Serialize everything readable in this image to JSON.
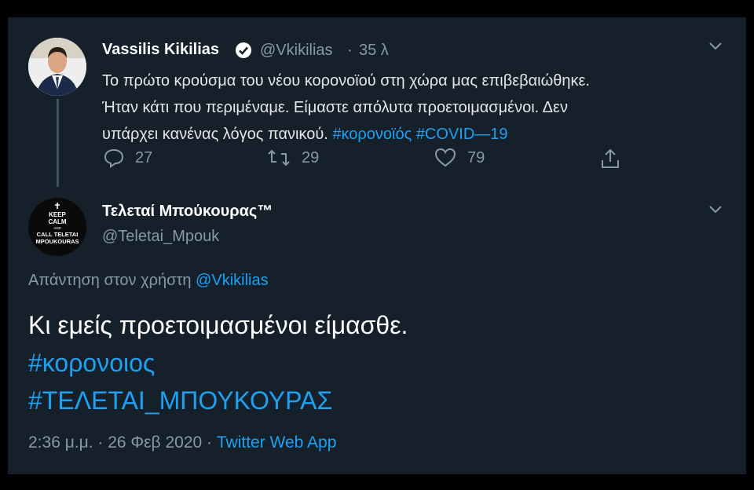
{
  "original_tweet": {
    "author_name": "Vassilis Kikilias",
    "handle": "@Vkikilias",
    "separator": "·",
    "time": "35 λ",
    "line1": "Το πρώτο κρούσμα του νέου κορονοϊού στη χώρα μας επιβεβαιώθηκε.",
    "line2": "Ήταν κάτι που περιμέναμε. Είμαστε απόλυτα προετοιμασμένοι. Δεν",
    "line3_text": "υπάρχει κανένας λόγος πανικού.",
    "hashtag1": "#κορονοϊός",
    "hashtag2": "#COVID—19",
    "reply_count": "27",
    "retweet_count": "29",
    "like_count": "79"
  },
  "reply_tweet": {
    "author_name": "Τελεταί Μπούκουρας™",
    "handle": "@Teletai_Mpouk",
    "avatar_lines": [
      "KEEP",
      "CALM",
      "AND",
      "CALL TELETAI",
      "MPOUKOURAS"
    ],
    "reply_to_prefix": "Απάντηση στον χρήστη",
    "reply_to_handle": "@Vkikilias",
    "main_text": "Κι εμείς προετοιμασμένοι είμασθε.",
    "hashtag1": "#κορονοιος",
    "hashtag2": "#ΤΕΛΕΤΑΙ_ΜΠΟΥΚΟΥΡΑΣ",
    "timestamp": "2:36 μ.μ. · 26 Φεβ 2020 ·",
    "source": "Twitter Web App"
  },
  "colors": {
    "background": "#15202b",
    "link": "#1da1f2",
    "muted": "#8899a6",
    "text": "#ffffff"
  }
}
